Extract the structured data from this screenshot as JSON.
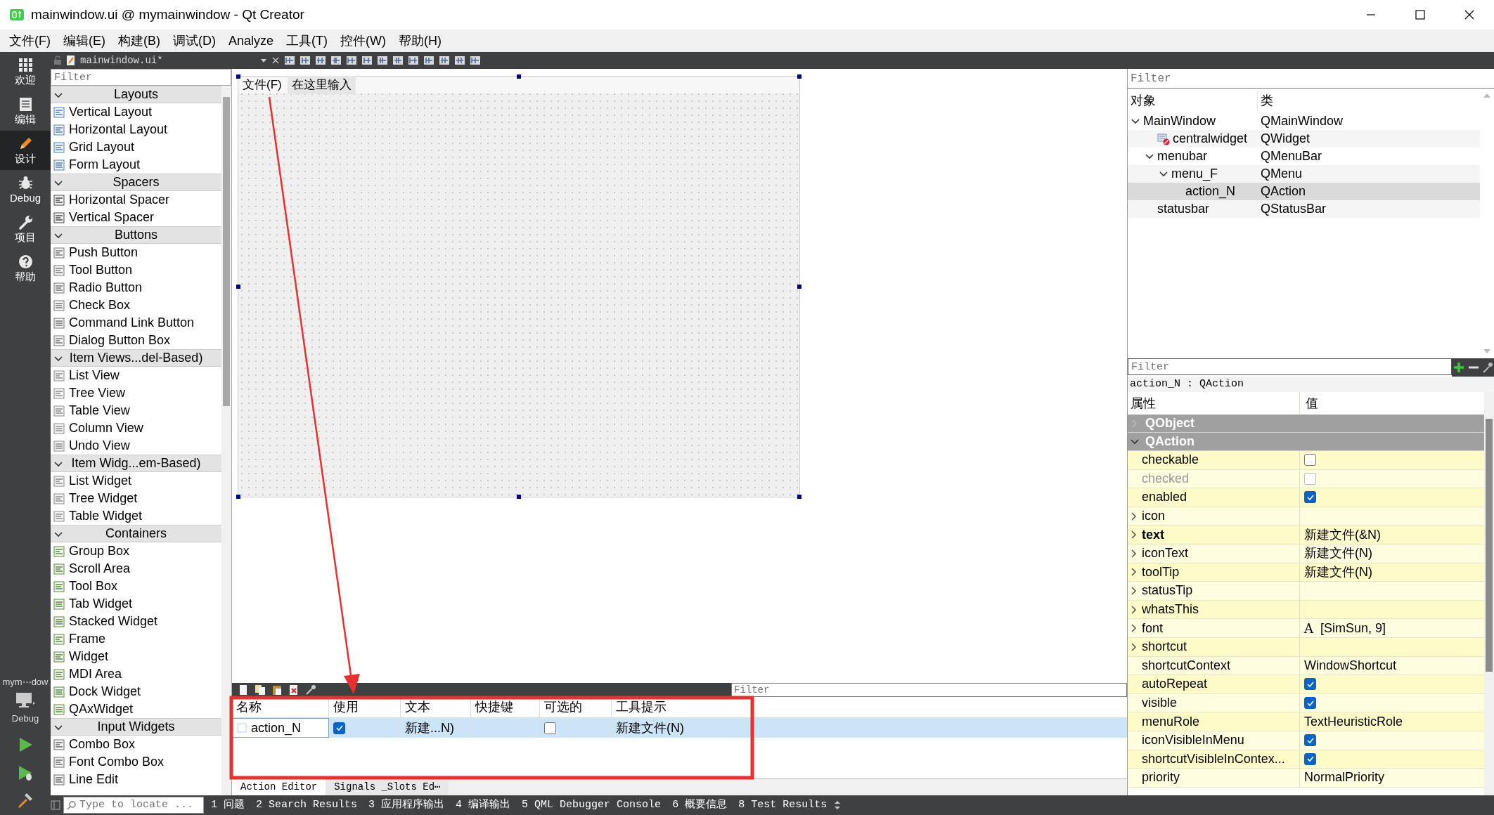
{
  "window": {
    "title": "mainwindow.ui @ mymainwindow - Qt Creator"
  },
  "menu": [
    "文件(F)",
    "编辑(E)",
    "构建(B)",
    "调试(D)",
    "Analyze",
    "工具(T)",
    "控件(W)",
    "帮助(H)"
  ],
  "mode_bar": [
    {
      "label": "欢迎",
      "kind": "grid",
      "selected": false
    },
    {
      "label": "编辑",
      "kind": "document",
      "selected": false
    },
    {
      "label": "设计",
      "kind": "pencil",
      "selected": true
    },
    {
      "label": "Debug",
      "kind": "bug",
      "selected": false
    },
    {
      "label": "项目",
      "kind": "wrench",
      "selected": false
    },
    {
      "label": "帮助",
      "kind": "help",
      "selected": false
    }
  ],
  "kit": {
    "project": "mym⋯dow",
    "build": "Debug"
  },
  "editor_toolbar": {
    "file": "mainwindow.ui*"
  },
  "widget_box": {
    "placeholder": "Filter",
    "groups": [
      {
        "title": "Layouts",
        "expanded": true,
        "items": [
          "Vertical Layout",
          "Horizontal Layout",
          "Grid Layout",
          "Form Layout"
        ]
      },
      {
        "title": "Spacers",
        "expanded": true,
        "items": [
          "Horizontal Spacer",
          "Vertical Spacer"
        ]
      },
      {
        "title": "Buttons",
        "expanded": true,
        "items": [
          "Push Button",
          "Tool Button",
          "Radio Button",
          "Check Box",
          "Command Link Button",
          "Dialog Button Box"
        ]
      },
      {
        "title": "Item Views...del-Based)",
        "expanded": true,
        "items": [
          "List View",
          "Tree View",
          "Table View",
          "Column View",
          "Undo View"
        ]
      },
      {
        "title": "Item Widg...em-Based)",
        "expanded": true,
        "items": [
          "List Widget",
          "Tree Widget",
          "Table Widget"
        ]
      },
      {
        "title": "Containers",
        "expanded": true,
        "items": [
          "Group Box",
          "Scroll Area",
          "Tool Box",
          "Tab Widget",
          "Stacked Widget",
          "Frame",
          "Widget",
          "MDI Area",
          "Dock Widget",
          "QAxWidget"
        ]
      },
      {
        "title": "Input Widgets",
        "expanded": true,
        "items": [
          "Combo Box",
          "Font Combo Box",
          "Line Edit"
        ]
      }
    ]
  },
  "form": {
    "menus": [
      {
        "label": "文件(F)",
        "kind": "menu"
      },
      {
        "label": "在这里输入",
        "kind": "placeholder"
      }
    ]
  },
  "action_editor": {
    "placeholder": "Filter",
    "columns": [
      "名称",
      "使用",
      "文本",
      "快捷键",
      "可选的",
      "工具提示"
    ],
    "rows": [
      {
        "name": "action_N",
        "used": true,
        "text": "新建...N)",
        "checkable": false,
        "tooltip": "新建文件(N)",
        "selected": true
      }
    ],
    "tabs": [
      {
        "label": "Action Editor",
        "selected": true
      },
      {
        "label": "Signals _Slots Ed⋯",
        "selected": false
      }
    ]
  },
  "status_bar": {
    "placeholder": "Type to locate ...",
    "panes": [
      "1 问题",
      "2 Search Results",
      "3 应用程序输出",
      "4 编译输出",
      "5 QML Debugger Console",
      "6 概要信息",
      "8 Test Results"
    ]
  },
  "object_inspector": {
    "placeholder": "Filter",
    "columns": [
      "对象",
      "类"
    ],
    "tree": [
      {
        "name": "MainWindow",
        "class": "QMainWindow",
        "has_icon": false,
        "selected": false,
        "expanded": true,
        "children": [
          {
            "name": "centralwidget",
            "class": "QWidget",
            "has_icon": true,
            "selected": false
          },
          {
            "name": "menubar",
            "class": "QMenuBar",
            "has_icon": false,
            "selected": false,
            "expanded": true,
            "children": [
              {
                "name": "menu_F",
                "class": "QMenu",
                "has_icon": false,
                "selected": false,
                "expanded": true,
                "children": [
                  {
                    "name": "action_N",
                    "class": "QAction",
                    "has_icon": false,
                    "selected": true
                  }
                ]
              }
            ]
          },
          {
            "name": "statusbar",
            "class": "QStatusBar",
            "has_icon": false,
            "selected": false
          }
        ]
      }
    ]
  },
  "property_editor": {
    "placeholder": "Filter",
    "object": "action_N : QAction",
    "columns": [
      "属性",
      "值"
    ],
    "groups": [
      {
        "title": "QObject",
        "expanded": false
      },
      {
        "title": "QAction",
        "expanded": true
      }
    ],
    "properties": [
      {
        "name": "checkable",
        "kind": "check",
        "checked": false,
        "expandable": false,
        "modified": false,
        "disabled": false
      },
      {
        "name": "checked",
        "kind": "check",
        "checked": false,
        "expandable": false,
        "modified": false,
        "disabled": true
      },
      {
        "name": "enabled",
        "kind": "check",
        "checked": true,
        "expandable": false,
        "modified": false,
        "disabled": false
      },
      {
        "name": "icon",
        "kind": "empty",
        "expandable": true,
        "modified": false,
        "disabled": false
      },
      {
        "name": "text",
        "kind": "text",
        "value": "新建文件(&N)",
        "expandable": true,
        "modified": true,
        "disabled": false
      },
      {
        "name": "iconText",
        "kind": "text",
        "value": "新建文件(N)",
        "expandable": true,
        "modified": false,
        "disabled": false
      },
      {
        "name": "toolTip",
        "kind": "text",
        "value": "新建文件(N)",
        "expandable": true,
        "modified": false,
        "disabled": false
      },
      {
        "name": "statusTip",
        "kind": "empty",
        "expandable": true,
        "modified": false,
        "disabled": false
      },
      {
        "name": "whatsThis",
        "kind": "empty",
        "expandable": true,
        "modified": false,
        "disabled": false
      },
      {
        "name": "font",
        "kind": "font",
        "preview": "A",
        "value": "[SimSun, 9]",
        "expandable": true,
        "modified": false,
        "disabled": false
      },
      {
        "name": "shortcut",
        "kind": "empty",
        "expandable": true,
        "modified": false,
        "disabled": false
      },
      {
        "name": "shortcutContext",
        "kind": "text",
        "value": "WindowShortcut",
        "expandable": false,
        "modified": false,
        "disabled": false
      },
      {
        "name": "autoRepeat",
        "kind": "check",
        "checked": true,
        "expandable": false,
        "modified": false,
        "disabled": false
      },
      {
        "name": "visible",
        "kind": "check",
        "checked": true,
        "expandable": false,
        "modified": false,
        "disabled": false
      },
      {
        "name": "menuRole",
        "kind": "text",
        "value": "TextHeuristicRole",
        "expandable": false,
        "modified": false,
        "disabled": false
      },
      {
        "name": "iconVisibleInMenu",
        "kind": "check",
        "checked": true,
        "expandable": false,
        "modified": false,
        "disabled": false
      },
      {
        "name": "shortcutVisibleInContex...",
        "kind": "check",
        "checked": true,
        "expandable": false,
        "modified": false,
        "disabled": false
      },
      {
        "name": "priority",
        "kind": "text",
        "value": "NormalPriority",
        "expandable": false,
        "modified": false,
        "disabled": false
      }
    ]
  }
}
